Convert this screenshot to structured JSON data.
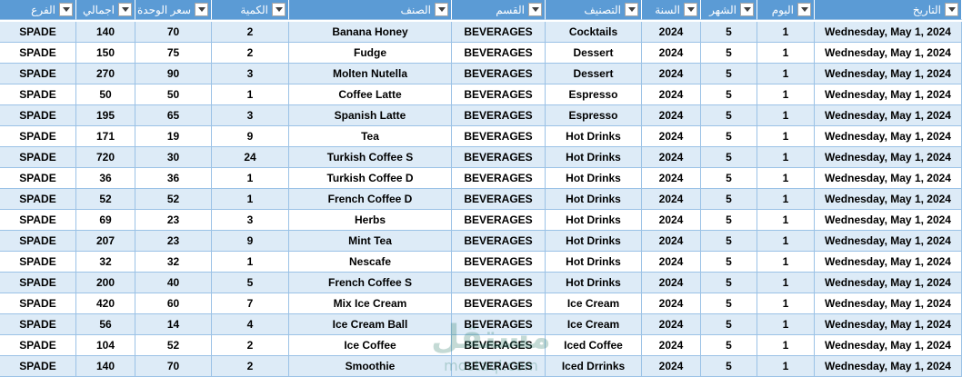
{
  "columns": [
    {
      "key": "branch",
      "header": "الفرع"
    },
    {
      "key": "total",
      "header": "اجمالي"
    },
    {
      "key": "unit_price",
      "header": "سعر الوحدة"
    },
    {
      "key": "qty",
      "header": "الكمية"
    },
    {
      "key": "item",
      "header": "الصنف"
    },
    {
      "key": "department",
      "header": "القسم"
    },
    {
      "key": "category",
      "header": "التصنيف"
    },
    {
      "key": "year",
      "header": "السنة"
    },
    {
      "key": "month",
      "header": "الشهر"
    },
    {
      "key": "day",
      "header": "اليوم"
    },
    {
      "key": "date",
      "header": "التاريخ"
    }
  ],
  "rows": [
    {
      "branch": "SPADE",
      "total": "140",
      "unit_price": "70",
      "qty": "2",
      "item": "Banana Honey",
      "department": "BEVERAGES",
      "category": "Cocktails",
      "year": "2024",
      "month": "5",
      "day": "1",
      "date": "Wednesday, May 1, 2024"
    },
    {
      "branch": "SPADE",
      "total": "150",
      "unit_price": "75",
      "qty": "2",
      "item": "Fudge",
      "department": "BEVERAGES",
      "category": "Dessert",
      "year": "2024",
      "month": "5",
      "day": "1",
      "date": "Wednesday, May 1, 2024"
    },
    {
      "branch": "SPADE",
      "total": "270",
      "unit_price": "90",
      "qty": "3",
      "item": "Molten Nutella",
      "department": "BEVERAGES",
      "category": "Dessert",
      "year": "2024",
      "month": "5",
      "day": "1",
      "date": "Wednesday, May 1, 2024"
    },
    {
      "branch": "SPADE",
      "total": "50",
      "unit_price": "50",
      "qty": "1",
      "item": "Coffee Latte",
      "department": "BEVERAGES",
      "category": "Espresso",
      "year": "2024",
      "month": "5",
      "day": "1",
      "date": "Wednesday, May 1, 2024"
    },
    {
      "branch": "SPADE",
      "total": "195",
      "unit_price": "65",
      "qty": "3",
      "item": "Spanish Latte",
      "department": "BEVERAGES",
      "category": "Espresso",
      "year": "2024",
      "month": "5",
      "day": "1",
      "date": "Wednesday, May 1, 2024"
    },
    {
      "branch": "SPADE",
      "total": "171",
      "unit_price": "19",
      "qty": "9",
      "item": "Tea",
      "department": "BEVERAGES",
      "category": "Hot Drinks",
      "year": "2024",
      "month": "5",
      "day": "1",
      "date": "Wednesday, May 1, 2024"
    },
    {
      "branch": "SPADE",
      "total": "720",
      "unit_price": "30",
      "qty": "24",
      "item": "Turkish Coffee S",
      "department": "BEVERAGES",
      "category": "Hot Drinks",
      "year": "2024",
      "month": "5",
      "day": "1",
      "date": "Wednesday, May 1, 2024"
    },
    {
      "branch": "SPADE",
      "total": "36",
      "unit_price": "36",
      "qty": "1",
      "item": "Turkish Coffee D",
      "department": "BEVERAGES",
      "category": "Hot Drinks",
      "year": "2024",
      "month": "5",
      "day": "1",
      "date": "Wednesday, May 1, 2024"
    },
    {
      "branch": "SPADE",
      "total": "52",
      "unit_price": "52",
      "qty": "1",
      "item": "French Coffee D",
      "department": "BEVERAGES",
      "category": "Hot Drinks",
      "year": "2024",
      "month": "5",
      "day": "1",
      "date": "Wednesday, May 1, 2024"
    },
    {
      "branch": "SPADE",
      "total": "69",
      "unit_price": "23",
      "qty": "3",
      "item": "Herbs",
      "department": "BEVERAGES",
      "category": "Hot Drinks",
      "year": "2024",
      "month": "5",
      "day": "1",
      "date": "Wednesday, May 1, 2024"
    },
    {
      "branch": "SPADE",
      "total": "207",
      "unit_price": "23",
      "qty": "9",
      "item": "Mint Tea",
      "department": "BEVERAGES",
      "category": "Hot Drinks",
      "year": "2024",
      "month": "5",
      "day": "1",
      "date": "Wednesday, May 1, 2024"
    },
    {
      "branch": "SPADE",
      "total": "32",
      "unit_price": "32",
      "qty": "1",
      "item": "Nescafe",
      "department": "BEVERAGES",
      "category": "Hot Drinks",
      "year": "2024",
      "month": "5",
      "day": "1",
      "date": "Wednesday, May 1, 2024"
    },
    {
      "branch": "SPADE",
      "total": "200",
      "unit_price": "40",
      "qty": "5",
      "item": "French Coffee S",
      "department": "BEVERAGES",
      "category": "Hot Drinks",
      "year": "2024",
      "month": "5",
      "day": "1",
      "date": "Wednesday, May 1, 2024"
    },
    {
      "branch": "SPADE",
      "total": "420",
      "unit_price": "60",
      "qty": "7",
      "item": "Mix Ice Cream",
      "department": "BEVERAGES",
      "category": "Ice Cream",
      "year": "2024",
      "month": "5",
      "day": "1",
      "date": "Wednesday, May 1, 2024"
    },
    {
      "branch": "SPADE",
      "total": "56",
      "unit_price": "14",
      "qty": "4",
      "item": "Ice Cream Ball",
      "department": "BEVERAGES",
      "category": "Ice Cream",
      "year": "2024",
      "month": "5",
      "day": "1",
      "date": "Wednesday, May 1, 2024"
    },
    {
      "branch": "SPADE",
      "total": "104",
      "unit_price": "52",
      "qty": "2",
      "item": "Ice Coffee",
      "department": "BEVERAGES",
      "category": "Iced Coffee",
      "year": "2024",
      "month": "5",
      "day": "1",
      "date": "Wednesday, May 1, 2024"
    },
    {
      "branch": "SPADE",
      "total": "140",
      "unit_price": "70",
      "qty": "2",
      "item": "Smoothie",
      "department": "BEVERAGES",
      "category": "Iced Drrinks",
      "year": "2024",
      "month": "5",
      "day": "1",
      "date": "Wednesday, May 1, 2024"
    }
  ],
  "watermark": {
    "brand": "مستقل",
    "domain": "mostaql.com"
  },
  "colors": {
    "header_bg": "#5b9bd5",
    "band_bg": "#ddebf7",
    "grid": "#9bc2e6"
  },
  "icons": {
    "filter": "chevron-down-icon"
  }
}
